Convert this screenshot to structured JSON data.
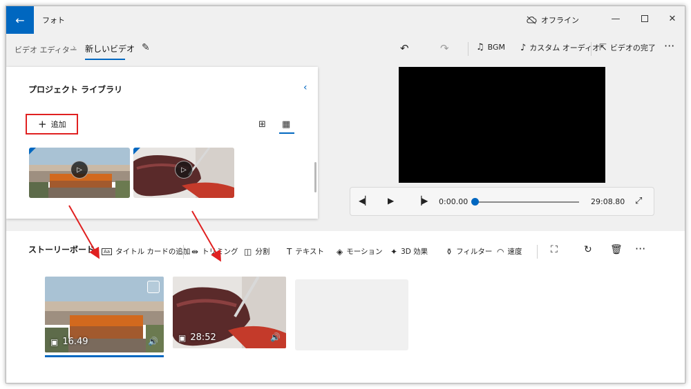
{
  "window": {
    "app_title": "フォト",
    "offline_label": "オフライン"
  },
  "breadcrumb": {
    "root": "ビデオ エディター",
    "current": "新しいビデオ"
  },
  "toolbar": {
    "bgm": "BGM",
    "custom_audio": "カスタム オーディオ",
    "finish_video": "ビデオの完了"
  },
  "library": {
    "title": "プロジェクト ライブラリ",
    "add_label": "追加"
  },
  "player": {
    "current_time": "0:00.00",
    "total_time": "29:08.80",
    "progress": 0
  },
  "storyboard": {
    "title": "ストーリーボード",
    "tools": {
      "title_card": "タイトル カードの追加",
      "trim": "トリミング",
      "split": "分割",
      "text": "テキスト",
      "motion": "モーション",
      "effects_3d": "3D 効果",
      "filter": "フィルター",
      "speed": "速度"
    },
    "clips": [
      {
        "duration": "16.49",
        "selected": true
      },
      {
        "duration": "28:52",
        "selected": false
      }
    ]
  },
  "colors": {
    "accent": "#0067c0",
    "highlight": "#e02020"
  }
}
